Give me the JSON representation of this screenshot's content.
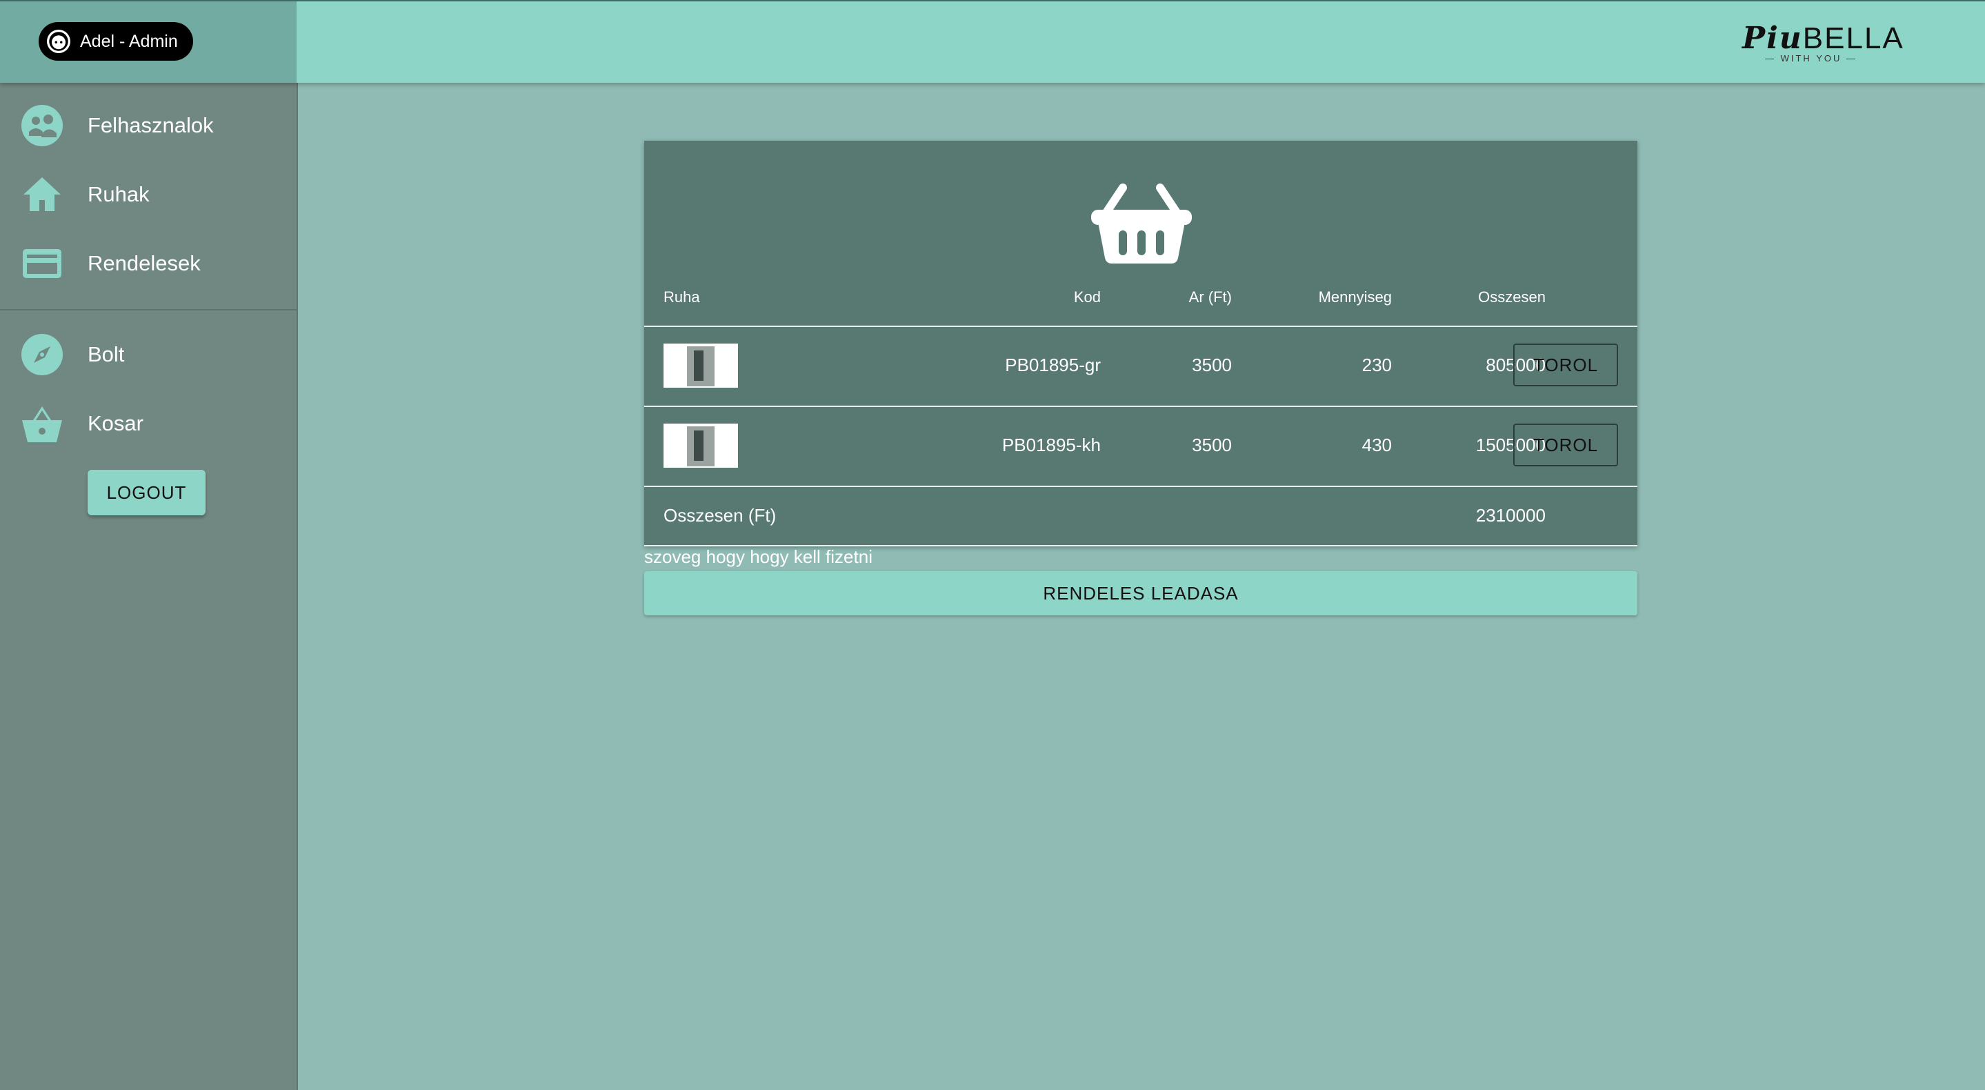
{
  "header": {
    "user_label": "Adel - Admin",
    "logo_main": "BELLA",
    "logo_script": "Piu",
    "logo_sub": "— WITH YOU —"
  },
  "sidebar": {
    "items": [
      {
        "label": "Felhasznalok",
        "icon": "users-icon"
      },
      {
        "label": "Ruhak",
        "icon": "home-icon"
      },
      {
        "label": "Rendelesek",
        "icon": "credit-card-icon"
      },
      {
        "label": "Bolt",
        "icon": "compass-icon"
      },
      {
        "label": "Kosar",
        "icon": "basket-icon"
      }
    ],
    "logout_label": "LOGOUT"
  },
  "cart": {
    "columns": [
      "Ruha",
      "Kod",
      "Ar (Ft)",
      "Mennyiseg",
      "Osszesen"
    ],
    "rows": [
      {
        "kod": "PB01895-gr",
        "ar": "3500",
        "mennyiseg": "230",
        "osszesen": "805000",
        "action": "TOROL"
      },
      {
        "kod": "PB01895-kh",
        "ar": "3500",
        "mennyiseg": "430",
        "osszesen": "1505000",
        "action": "TOROL"
      }
    ],
    "total_label": "Osszesen (Ft)",
    "total_value": "2310000",
    "note": "szoveg hogy hogy kell fizetni",
    "order_button": "RENDELES LEADASA"
  },
  "colors": {
    "accent": "#8dd5c7",
    "sidebar": "#718882",
    "card": "#587872",
    "background": "#8fbbb4"
  }
}
